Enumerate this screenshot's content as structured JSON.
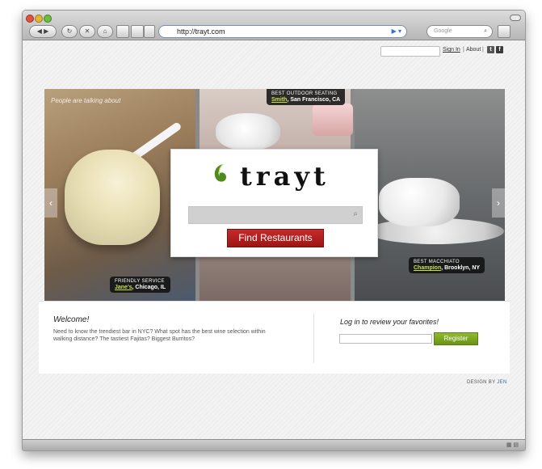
{
  "browser": {
    "url": "http://trayt.com",
    "search_placeholder": "Google",
    "back_icon": "back-arrow-icon",
    "forward_icon": "forward-arrow-icon",
    "reload_icon": "reload-icon",
    "stop_icon": "stop-icon",
    "home_icon": "home-icon"
  },
  "topbar": {
    "sign_in": "Sign In",
    "separator": "|",
    "about": "About",
    "separator2": "|",
    "twitter": "t",
    "facebook": "f"
  },
  "hero": {
    "caption": "People are talking about",
    "tags": [
      {
        "label": "BEST OUTDOOR SEATING",
        "name": "Smith",
        "location": ", San Francisco, CA"
      },
      {
        "label": "FRIENDLY SERVICE",
        "name": "Jane's",
        "location": ", Chicago, IL"
      },
      {
        "label": "BEST MACCHIATO",
        "name": "Champion",
        "location": ", Brooklyn, NY"
      }
    ],
    "prev_arrow": "‹",
    "next_arrow": "›"
  },
  "card": {
    "logo_text": "trayt",
    "search_value": "",
    "find_button": "Find Restaurants"
  },
  "welcome": {
    "title": "Welcome!",
    "text": "Need to know the trendiest bar in NYC? What spot has the best wine selection within walking distance? The tastiest Fajitas? Biggest Burritos?"
  },
  "login": {
    "title": "Log in to review your favorites!",
    "register_button": "Register"
  },
  "footer": {
    "credit_prefix": "DESIGN BY ",
    "credit_name": "JEN"
  },
  "colors": {
    "accent_red": "#b52222",
    "accent_green": "#7aa523",
    "link_blue": "#2b6aa8"
  }
}
